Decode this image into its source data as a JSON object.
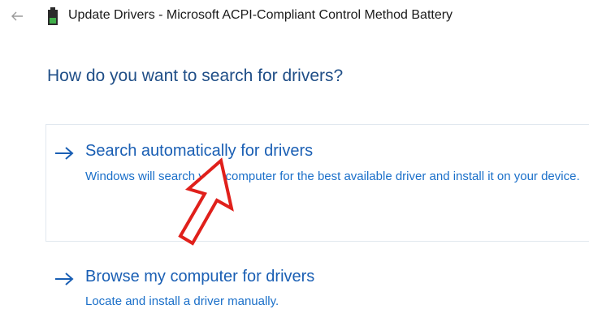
{
  "window": {
    "title": "Update Drivers - Microsoft ACPI-Compliant Control Method Battery",
    "back_icon": "arrow-left-icon",
    "device_icon": "battery-icon"
  },
  "page": {
    "heading": "How do you want to search for drivers?"
  },
  "options": [
    {
      "title": "Search automatically for drivers",
      "description": "Windows will search your computer for the best available driver and install it on your device.",
      "icon": "arrow-right-icon"
    },
    {
      "title": "Browse my computer for drivers",
      "description": "Locate and install a driver manually.",
      "icon": "arrow-right-icon"
    }
  ],
  "annotation": {
    "icon": "red-pointer-arrow-icon",
    "color": "#e0201b"
  },
  "colors": {
    "heading": "#1f4e87",
    "link": "#1a5fb4",
    "border": "#e1e8ef"
  }
}
